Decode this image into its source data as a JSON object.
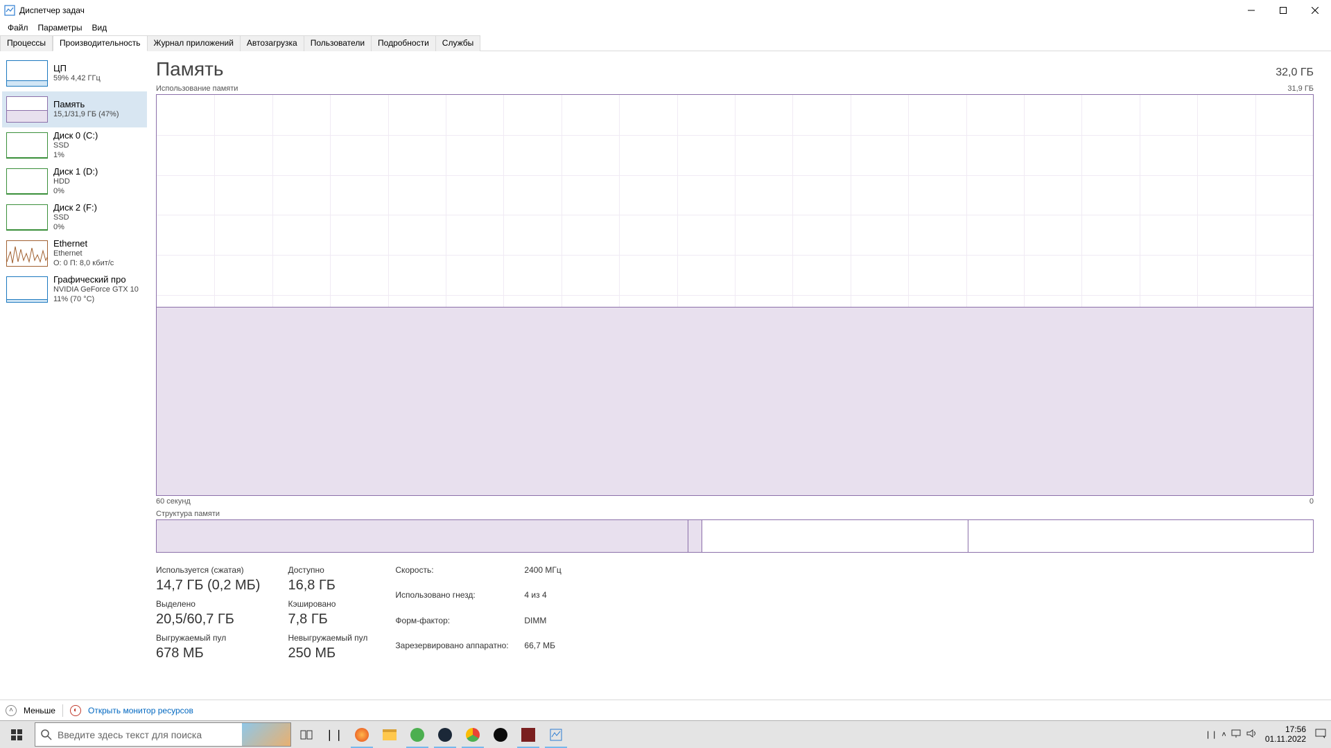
{
  "window": {
    "title": "Диспетчер задач"
  },
  "menu": {
    "file": "Файл",
    "options": "Параметры",
    "view": "Вид"
  },
  "tabs": {
    "processes": "Процессы",
    "performance": "Производительность",
    "app_history": "Журнал приложений",
    "startup": "Автозагрузка",
    "users": "Пользователи",
    "details": "Подробности",
    "services": "Службы"
  },
  "sidebar": [
    {
      "name": "ЦП",
      "sub1": "59% 4,42 ГГц",
      "kind": "cpu"
    },
    {
      "name": "Память",
      "sub1": "15,1/31,9 ГБ (47%)",
      "kind": "mem"
    },
    {
      "name": "Диск 0 (C:)",
      "sub1": "SSD",
      "sub2": "1%",
      "kind": "disk"
    },
    {
      "name": "Диск 1 (D:)",
      "sub1": "HDD",
      "sub2": "0%",
      "kind": "disk"
    },
    {
      "name": "Диск 2 (F:)",
      "sub1": "SSD",
      "sub2": "0%",
      "kind": "disk"
    },
    {
      "name": "Ethernet",
      "sub1": "Ethernet",
      "sub2": "О: 0 П: 8,0 кбит/с",
      "kind": "eth"
    },
    {
      "name": "Графический про",
      "sub1": "NVIDIA GeForce GTX 10",
      "sub2": "11% (70 °C)",
      "kind": "gpu"
    }
  ],
  "main": {
    "title": "Память",
    "total": "32,0 ГБ",
    "graph_label": "Использование памяти",
    "graph_max": "31,9 ГБ",
    "graph_min": "0",
    "graph_left": "60 секунд",
    "comp_label": "Структура памяти"
  },
  "stats": {
    "used_lbl": "Используется (сжатая)",
    "used_val": "14,7 ГБ (0,2 МБ)",
    "avail_lbl": "Доступно",
    "avail_val": "16,8 ГБ",
    "commit_lbl": "Выделено",
    "commit_val": "20,5/60,7 ГБ",
    "cached_lbl": "Кэшировано",
    "cached_val": "7,8 ГБ",
    "paged_lbl": "Выгружаемый пул",
    "paged_val": "678 МБ",
    "nonpaged_lbl": "Невыгружаемый пул",
    "nonpaged_val": "250 МБ",
    "speed_lbl": "Скорость:",
    "speed_val": "2400 МГц",
    "slots_lbl": "Использовано гнезд:",
    "slots_val": "4 из 4",
    "form_lbl": "Форм-фактор:",
    "form_val": "DIMM",
    "hw_lbl": "Зарезервировано аппаратно:",
    "hw_val": "66,7 МБ"
  },
  "footer": {
    "fewer": "Меньше",
    "resmon": "Открыть монитор ресурсов"
  },
  "taskbar": {
    "search_placeholder": "Введите здесь текст для поиска",
    "time": "17:56",
    "date": "01.11.2022"
  },
  "chart_data": {
    "type": "area",
    "title": "Использование памяти",
    "xlabel": "60 секунд → 0",
    "ylabel": "ГБ",
    "ylim": [
      0,
      31.9
    ],
    "x": [
      60,
      55,
      50,
      45,
      40,
      35,
      30,
      25,
      20,
      15,
      10,
      5,
      0
    ],
    "values": [
      15.0,
      15.0,
      15.0,
      15.0,
      15.0,
      15.0,
      15.1,
      15.1,
      15.1,
      15.1,
      15.1,
      15.1,
      15.1
    ]
  }
}
